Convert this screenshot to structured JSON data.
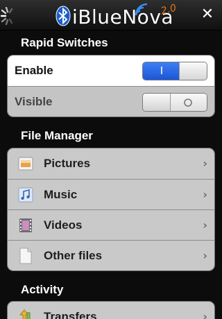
{
  "header": {
    "app_name": "iBlueNova",
    "version": "2.0",
    "close_label": "✕"
  },
  "rapid_switches": {
    "title": "Rapid Switches",
    "enable": {
      "label": "Enable",
      "state": "on",
      "on_symbol": "I"
    },
    "visible": {
      "label": "Visible",
      "state": "off",
      "off_symbol": "O"
    }
  },
  "file_manager": {
    "title": "File Manager",
    "items": [
      {
        "label": "Pictures",
        "icon": "pictures-icon"
      },
      {
        "label": "Music",
        "icon": "music-icon"
      },
      {
        "label": "Videos",
        "icon": "videos-icon"
      },
      {
        "label": "Other files",
        "icon": "file-icon"
      }
    ]
  },
  "activity": {
    "title": "Activity",
    "items": [
      {
        "label": "Transfers",
        "icon": "transfers-icon"
      }
    ]
  },
  "colors": {
    "toggle_on": "#2a66e6",
    "version_accent": "#e07a10",
    "background": "#0c0c0c"
  }
}
